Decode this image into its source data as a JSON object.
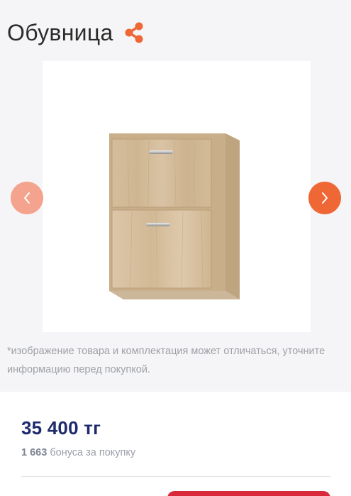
{
  "product": {
    "title": "Обувница",
    "share_icon": "share-icon",
    "disclaimer": "*изображение товара и комплектация может отличаться, уточните информацию перед покупкой."
  },
  "gallery": {
    "prev_icon": "chevron-left-icon",
    "next_icon": "chevron-right-icon"
  },
  "pricing": {
    "price": "35 400 тг",
    "bonus_amount": "1 663",
    "bonus_text": "бонуса за покупку"
  },
  "colors": {
    "accent": "#ef6734",
    "accent_light": "#f3a38e",
    "price": "#1d2a6b",
    "buy_button": "#d8283a"
  }
}
